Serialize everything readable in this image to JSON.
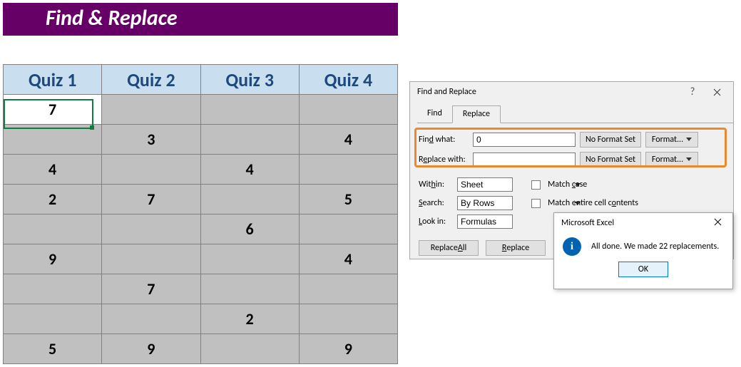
{
  "banner_title": "Find & Replace",
  "columns": [
    "Quiz 1",
    "Quiz 2",
    "Quiz 3",
    "Quiz 4"
  ],
  "rows": [
    [
      "7",
      "",
      "",
      ""
    ],
    [
      "",
      "3",
      "",
      "4"
    ],
    [
      "4",
      "",
      "4",
      ""
    ],
    [
      "2",
      "7",
      "",
      "5"
    ],
    [
      "",
      "",
      "6",
      ""
    ],
    [
      "9",
      "",
      "",
      "4"
    ],
    [
      "",
      "7",
      "",
      ""
    ],
    [
      "",
      "",
      "2",
      ""
    ],
    [
      "5",
      "9",
      "",
      "9"
    ]
  ],
  "dialog": {
    "title": "Find and Replace",
    "tab_find": "Find",
    "tab_replace": "Replace",
    "find_label": "Find what:",
    "find_value": "0",
    "replace_label": "Replace with:",
    "replace_value": "",
    "no_format": "No Format Set",
    "format_btn": "Format...",
    "within_label": "Within:",
    "within_value": "Sheet",
    "search_label": "Search:",
    "search_value": "By Rows",
    "lookin_label": "Look in:",
    "lookin_value": "Formulas",
    "match_case": "Match case",
    "match_entire": "Match entire cell contents",
    "replace_all": "Replace All",
    "replace_btn": "Replace"
  },
  "msg": {
    "title": "Microsoft Excel",
    "text": "All done. We made 22 replacements.",
    "ok": "OK"
  },
  "chart_data": {
    "type": "table",
    "note": "Spreadsheet data after replacing 0 with blank (22 replacements made)",
    "columns": [
      "Quiz 1",
      "Quiz 2",
      "Quiz 3",
      "Quiz 4"
    ],
    "rows": [
      [
        7,
        null,
        null,
        null
      ],
      [
        null,
        3,
        null,
        4
      ],
      [
        4,
        null,
        4,
        null
      ],
      [
        2,
        7,
        null,
        5
      ],
      [
        null,
        null,
        6,
        null
      ],
      [
        9,
        null,
        null,
        4
      ],
      [
        null,
        7,
        null,
        null
      ],
      [
        null,
        null,
        2,
        null
      ],
      [
        5,
        9,
        null,
        9
      ]
    ]
  }
}
